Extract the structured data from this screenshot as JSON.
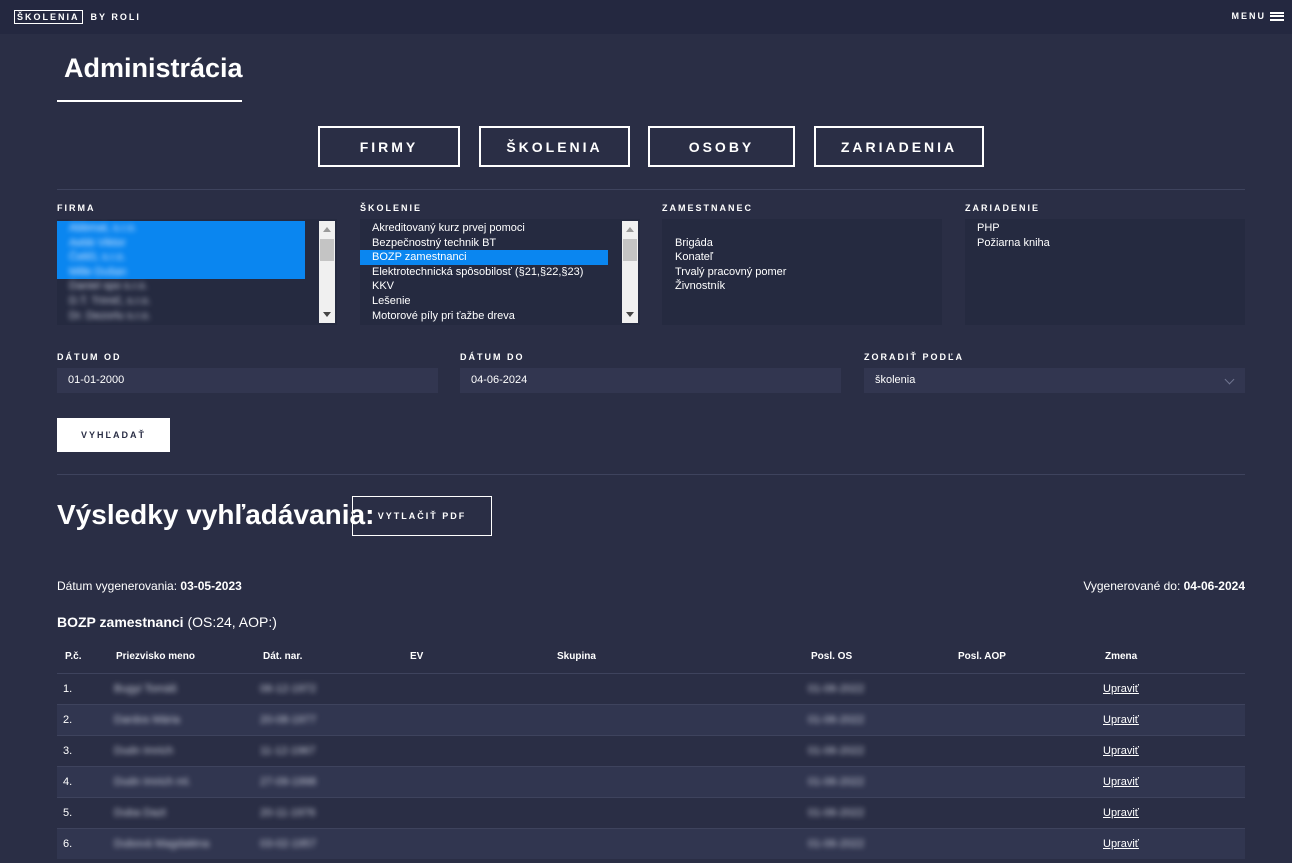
{
  "header": {
    "brand_box": "ŠKOLENIA",
    "brand_by": "BY ROLI",
    "menu_label": "MENU"
  },
  "page": {
    "title": "Administrácia"
  },
  "nav": [
    "FIRMY",
    "ŠKOLENIA",
    "OSOBY",
    "ZARIADENIA"
  ],
  "filters": {
    "firma": {
      "label": "FIRMA",
      "options": [
        {
          "text": "Abbmat, s.r.o.",
          "selected": true
        },
        {
          "text": "Aebb Viktor",
          "selected": true
        },
        {
          "text": "Čeliči, s.r.o.",
          "selected": true
        },
        {
          "text": "Mille Dušan",
          "selected": true
        },
        {
          "text": "Daniel spo s.r.o.",
          "selected": false
        },
        {
          "text": "D.T. Trimič, s.r.o.",
          "selected": false
        },
        {
          "text": "Dr. Dezorlu s.r.o.",
          "selected": false
        }
      ]
    },
    "skolenie": {
      "label": "ŠKOLENIE",
      "options": [
        {
          "text": "Akreditovaný kurz prvej pomoci",
          "selected": false
        },
        {
          "text": "Bezpečnostný technik BT",
          "selected": false
        },
        {
          "text": "BOZP zamestnanci",
          "selected": true
        },
        {
          "text": "Elektrotechnická spôsobilosť (§21,§22,§23)",
          "selected": false
        },
        {
          "text": "KKV",
          "selected": false
        },
        {
          "text": "Lešenie",
          "selected": false
        },
        {
          "text": "Motorové píly pri ťažbe dreva",
          "selected": false
        }
      ]
    },
    "zamestnanec": {
      "label": "ZAMESTNANEC",
      "options": [
        {
          "text": "",
          "selected": false
        },
        {
          "text": "Brigáda",
          "selected": false
        },
        {
          "text": "Konateľ",
          "selected": false
        },
        {
          "text": "Trvalý pracovný pomer",
          "selected": false
        },
        {
          "text": "Živnostník",
          "selected": false
        }
      ]
    },
    "zariadenie": {
      "label": "ZARIADENIE",
      "options": [
        {
          "text": "PHP",
          "selected": false
        },
        {
          "text": "Požiarna kniha",
          "selected": false
        }
      ]
    },
    "datum_od": {
      "label": "DÁTUM OD",
      "value": "01-01-2000"
    },
    "datum_do": {
      "label": "DÁTUM DO",
      "value": "04-06-2024"
    },
    "zoradit": {
      "label": "ZORADIŤ PODĽA",
      "value": "školenia"
    },
    "search_button": "VYHĽADAŤ"
  },
  "results": {
    "title": "Výsledky vyhľadávania:",
    "pdf_button": "VYTLAČIŤ PDF",
    "generated_label": "Dátum vygenerovania: ",
    "generated_value": "03-05-2023",
    "generated_to_label": "Vygenerované do: ",
    "generated_to_value": "04-06-2024",
    "section_name": "BOZP zamestnanci",
    "section_counts": "(OS:24, AOP:)",
    "columns": [
      "P.č.",
      "Priezvisko meno",
      "Dát. nar.",
      "EV",
      "Skupina",
      "Posl. OS",
      "Posl. AOP",
      "Zmena"
    ],
    "rows": [
      {
        "pc": "1.",
        "name": "Bugyi Tomáš",
        "dob": "06-12-1972",
        "ev": "",
        "skupina": "",
        "posl_os": "01-06-2022",
        "posl_aop": "",
        "zmena": "Upraviť"
      },
      {
        "pc": "2.",
        "name": "Dardos Mária",
        "dob": "20-08-1977",
        "ev": "",
        "skupina": "",
        "posl_os": "01-06-2022",
        "posl_aop": "",
        "zmena": "Upraviť"
      },
      {
        "pc": "3.",
        "name": "Dudn Imrich",
        "dob": "11-12-1967",
        "ev": "",
        "skupina": "",
        "posl_os": "01-06-2022",
        "posl_aop": "",
        "zmena": "Upraviť"
      },
      {
        "pc": "4.",
        "name": "Dudn Imrich ml.",
        "dob": "27-09-1998",
        "ev": "",
        "skupina": "",
        "posl_os": "01-06-2022",
        "posl_aop": "",
        "zmena": "Upraviť"
      },
      {
        "pc": "5.",
        "name": "Duba Dazt",
        "dob": "20-11-1976",
        "ev": "",
        "skupina": "",
        "posl_os": "01-06-2022",
        "posl_aop": "",
        "zmena": "Upraviť"
      },
      {
        "pc": "6.",
        "name": "Dubová Magdaléna",
        "dob": "03-02-1957",
        "ev": "",
        "skupina": "",
        "posl_os": "01-06-2022",
        "posl_aop": "",
        "zmena": "Upraviť"
      }
    ]
  },
  "colors": {
    "background": "#2a2e45",
    "topbar": "#242840",
    "listbox": "#252a40",
    "input": "#323650",
    "selection": "#0a86f0",
    "row_alt": "#313650"
  }
}
